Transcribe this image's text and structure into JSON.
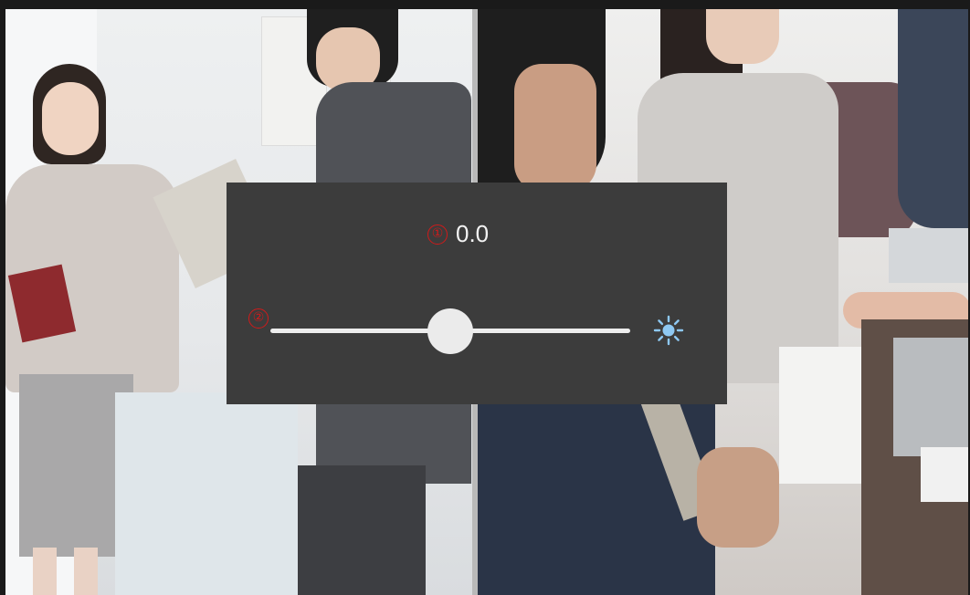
{
  "overlay": {
    "badge_1": "①",
    "badge_2": "②",
    "value": "0.0",
    "slider_level": 0.5,
    "icon": "sun-icon",
    "colors": {
      "panel": "#3c3c3c",
      "badge": "#d21a1a",
      "icon": "#8ec8f2"
    }
  }
}
